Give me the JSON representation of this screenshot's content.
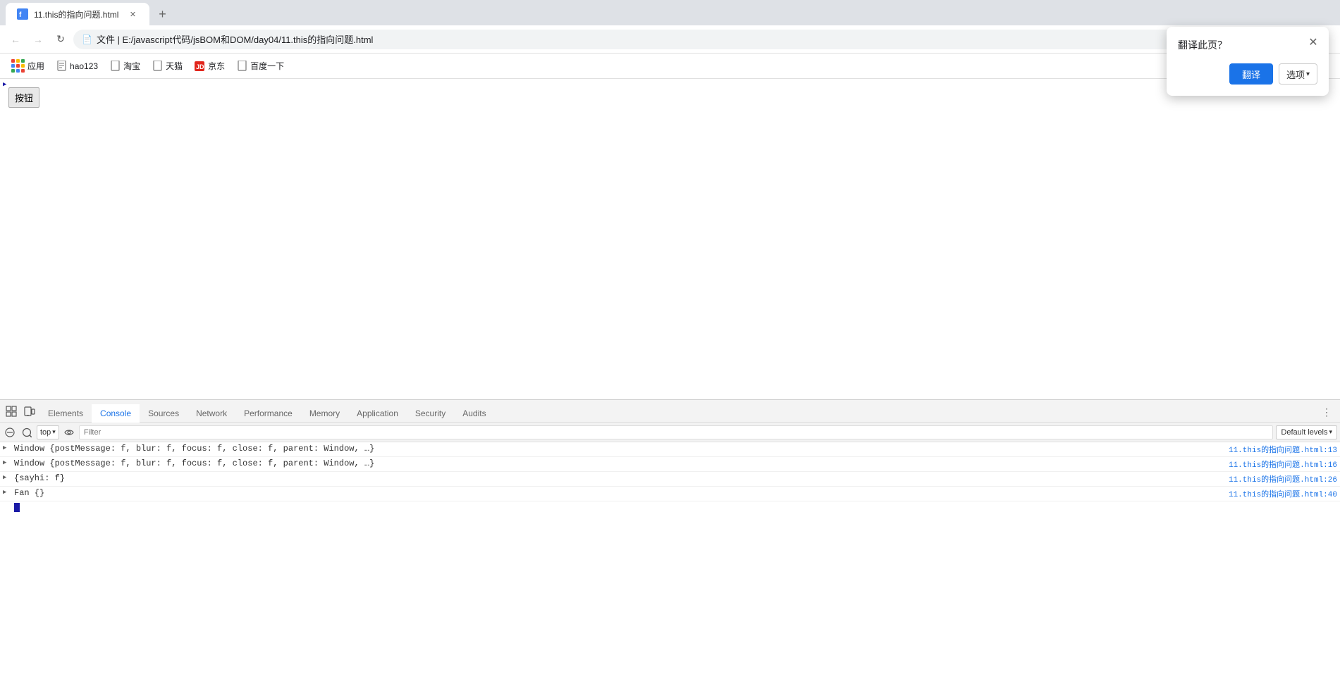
{
  "browser": {
    "tab_title": "11.this的指向问题.html",
    "address": "文件 | E:/javascript代码/jsBOM和DOM/day04/11.this的指向问题.html",
    "bookmarks": [
      {
        "label": "应用",
        "icon": "grid"
      },
      {
        "label": "hao123",
        "icon": "doc"
      },
      {
        "label": "淘宝",
        "icon": "doc"
      },
      {
        "label": "天猫",
        "icon": "doc"
      },
      {
        "label": "京东",
        "icon": "jd"
      },
      {
        "label": "百度一下",
        "icon": "doc"
      }
    ]
  },
  "page": {
    "button_label": "按钮"
  },
  "devtools": {
    "tabs": [
      "Elements",
      "Console",
      "Sources",
      "Network",
      "Performance",
      "Memory",
      "Application",
      "Security",
      "Audits"
    ],
    "active_tab": "Console",
    "context": "top",
    "filter_placeholder": "Filter",
    "levels": "Default levels",
    "console_rows": [
      {
        "expand": true,
        "text": "Window {postMessage: f, blur: f, focus: f, close: f, parent: Window, …}",
        "link": "11.this的指向问题.html:13"
      },
      {
        "expand": true,
        "text": "Window {postMessage: f, blur: f, focus: f, close: f, parent: Window, …}",
        "link": "11.this的指向问题.html:16"
      },
      {
        "expand": true,
        "text": "{sayhi: f}",
        "link": "11.this的指向问题.html:26"
      },
      {
        "expand": true,
        "text": "Fan {}",
        "link": "11.this的指向问题.html:40"
      }
    ]
  },
  "translate_popup": {
    "title": "翻译此页？",
    "translate_btn": "翻译",
    "options_btn": "选项",
    "close_title": "关闭"
  },
  "icons": {
    "back": "←",
    "forward": "→",
    "reload": "↻",
    "lock": "🔒",
    "bookmark": "☆",
    "profile": "👤",
    "more_vert": "⋮",
    "expand_right": "▶",
    "chevron_down": "▾",
    "close": "✕",
    "new_tab": "+"
  }
}
